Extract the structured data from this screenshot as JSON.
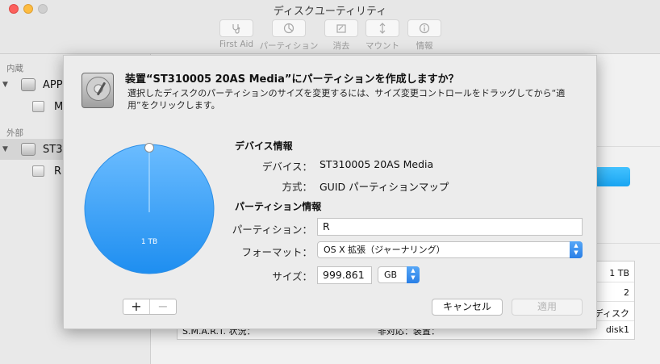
{
  "window": {
    "title": "ディスクユーティリティ"
  },
  "toolbar": [
    {
      "label": "First Aid",
      "icon": "stethoscope-icon"
    },
    {
      "label": "パーティション",
      "icon": "partition-icon"
    },
    {
      "label": "消去",
      "icon": "erase-icon"
    },
    {
      "label": "マウント",
      "icon": "mount-icon"
    },
    {
      "label": "情報",
      "icon": "info-icon"
    }
  ],
  "sidebar": {
    "internal_header": "内蔵",
    "external_header": "外部",
    "items": [
      {
        "label": "APP",
        "icon": "internal-disk-icon"
      },
      {
        "label": "M",
        "icon": "volume-icon"
      },
      {
        "label": "ST3",
        "icon": "external-disk-icon"
      },
      {
        "label": "R",
        "icon": "volume-icon"
      }
    ]
  },
  "background_info": {
    "rows": [
      {
        "value": "1 TB"
      },
      {
        "value": "2"
      },
      {
        "value": "ディスク"
      },
      {
        "label": "S.M.A.R.T. 状況：",
        "label2": "非対応：装置：",
        "value": "disk1"
      }
    ]
  },
  "dialog": {
    "title": "装置“ST310005 20AS Media”にパーティションを作成しますか？",
    "description": "選択したディスクのパーティションのサイズを変更するには、サイズ変更コントロールをドラッグしてから“適用”をクリックします。",
    "pie": {
      "label": "1 TB",
      "color": "#3aa1f5"
    },
    "add_label": "+",
    "remove_label": "−",
    "device_info": {
      "heading": "デバイス情報",
      "device_label": "デバイス：",
      "device_value": "ST310005 20AS Media",
      "scheme_label": "方式：",
      "scheme_value": "GUID パーティションマップ"
    },
    "partition_info": {
      "heading": "パーティション情報",
      "name_label": "パーティション：",
      "name_value": "R",
      "format_label": "フォーマット：",
      "format_value": "OS X 拡張（ジャーナリング）",
      "size_label": "サイズ：",
      "size_value": "999.861",
      "unit_value": "GB"
    },
    "cancel_label": "キャンセル",
    "apply_label": "適用"
  }
}
